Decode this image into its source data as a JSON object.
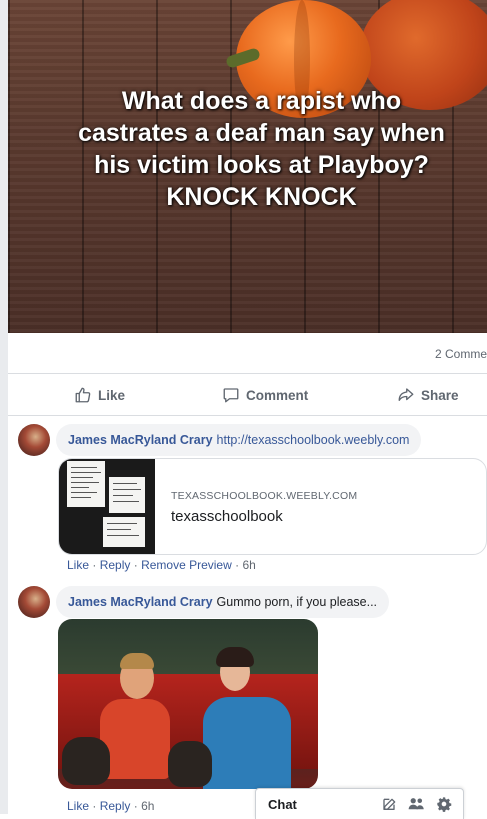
{
  "post": {
    "image_caption_lines": [
      "What does a rapist who",
      "castrates a deaf man say when",
      "his victim looks at Playboy?",
      "KNOCK KNOCK"
    ],
    "comments_count": "2 Comme"
  },
  "actions": {
    "like": "Like",
    "comment": "Comment",
    "share": "Share"
  },
  "comments": [
    {
      "author": "James MacRyland Crary",
      "text": "http://texasschoolbook.weebly.com",
      "link_preview": {
        "domain": "TEXASSCHOOLBOOK.WEEBLY.COM",
        "title": "texasschoolbook"
      },
      "meta": {
        "like": "Like",
        "reply": "Reply",
        "remove_preview": "Remove Preview",
        "time": "6h",
        "sep": "·"
      }
    },
    {
      "author": "James MacRyland Crary",
      "text": "Gummo porn, if you please...",
      "meta": {
        "like": "Like",
        "reply": "Reply",
        "time": "6h",
        "sep": "·"
      }
    }
  ],
  "chat": {
    "label": "Chat",
    "icons": [
      "compose-icon",
      "people-icon",
      "gear-icon"
    ]
  },
  "colors": {
    "link_blue": "#385898",
    "meta_gray": "#606770",
    "bubble_bg": "#f2f3f5"
  }
}
